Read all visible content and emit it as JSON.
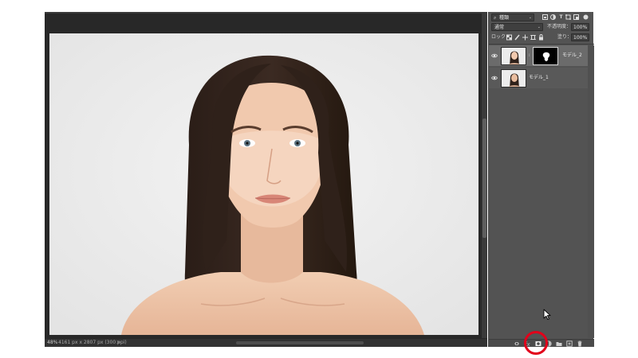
{
  "status_bar": {
    "zoom": "48%",
    "doc_info": "4161 px x 2807 px (300 ppi)",
    "arrow": ">"
  },
  "layers_panel": {
    "filter": {
      "label": "種類",
      "caret": "⌄"
    },
    "blend": {
      "mode": "通常",
      "caret": "⌄",
      "opacity_label": "不透明度：",
      "opacity_value": "100%"
    },
    "lock": {
      "label": "ロック：",
      "fill_label": "塗り：",
      "fill_value": "100%"
    },
    "layers": [
      {
        "name": "モデル_2",
        "has_mask": true,
        "selected": true,
        "visible": true
      },
      {
        "name": "モデル_1",
        "has_mask": false,
        "selected": false,
        "visible": true
      }
    ],
    "bottom_icons": [
      "link-icon",
      "fx-icon",
      "add-mask-icon",
      "folder-icon",
      "new-layer-icon",
      "trash-icon"
    ]
  },
  "annotation": {
    "highlight_target": "add-mask-icon",
    "color": "#e2001a"
  },
  "colors": {
    "canvas_bg": "#ececec",
    "panel_bg": "#535353",
    "doc_bg": "#282828"
  }
}
